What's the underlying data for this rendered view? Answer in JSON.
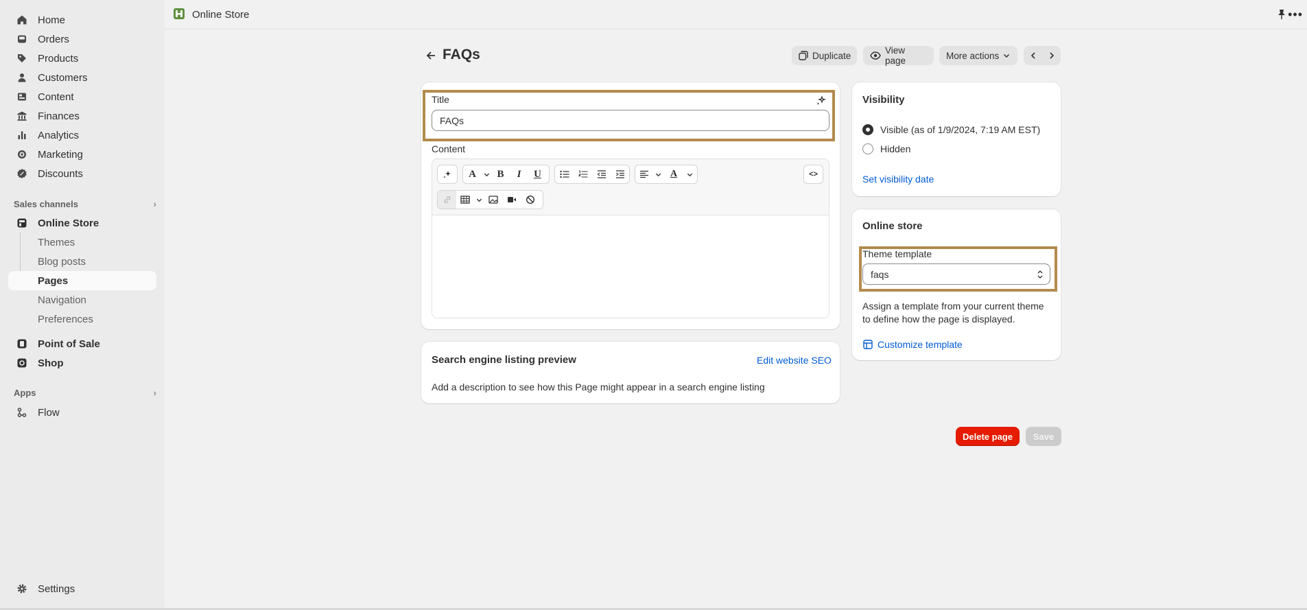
{
  "sidebar": {
    "items": [
      {
        "label": "Home",
        "icon": "home-icon"
      },
      {
        "label": "Orders",
        "icon": "inbox-icon"
      },
      {
        "label": "Products",
        "icon": "tag-icon"
      },
      {
        "label": "Customers",
        "icon": "person-icon"
      },
      {
        "label": "Content",
        "icon": "image-icon"
      },
      {
        "label": "Finances",
        "icon": "bank-icon"
      },
      {
        "label": "Analytics",
        "icon": "bar-chart-icon"
      },
      {
        "label": "Marketing",
        "icon": "target-icon"
      },
      {
        "label": "Discounts",
        "icon": "discount-icon"
      }
    ],
    "sales_channels_label": "Sales channels",
    "online_store": {
      "label": "Online Store",
      "sub_items": [
        "Themes",
        "Blog posts",
        "Pages",
        "Navigation",
        "Preferences"
      ],
      "active": "Pages"
    },
    "point_of_sale": "Point of Sale",
    "shop": "Shop",
    "apps_label": "Apps",
    "flow": "Flow",
    "settings": "Settings"
  },
  "topbar": {
    "app_name": "Online Store"
  },
  "header": {
    "title": "FAQs",
    "duplicate": "Duplicate",
    "view_page": "View page",
    "more_actions": "More actions"
  },
  "main": {
    "title_label": "Title",
    "title_value": "FAQs",
    "content_label": "Content"
  },
  "seo": {
    "title": "Search engine listing preview",
    "edit_link": "Edit website SEO",
    "description": "Add a description to see how this Page might appear in a search engine listing"
  },
  "visibility": {
    "title": "Visibility",
    "visible_label": "Visible (as of 1/9/2024, 7:19 AM EST)",
    "hidden_label": "Hidden",
    "set_date_link": "Set visibility date"
  },
  "online_store_card": {
    "title": "Online store",
    "template_label": "Theme template",
    "template_value": "faqs",
    "help_line1": "Assign a template from your current theme",
    "help_line2": "to define how the page is displayed.",
    "customize_link": "Customize template"
  },
  "actions": {
    "delete": "Delete page",
    "save": "Save"
  },
  "colors": {
    "accent_link": "#005bd3",
    "danger": "#e51c00",
    "highlight": "#b38b4d"
  }
}
